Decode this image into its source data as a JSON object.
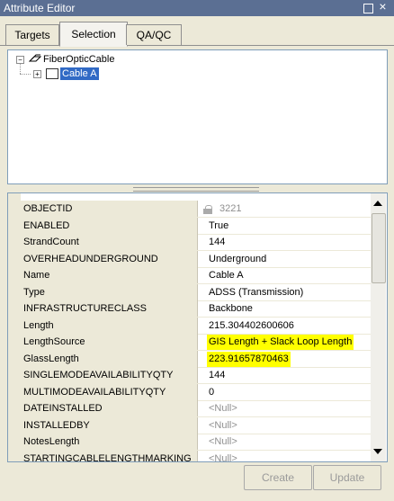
{
  "window": {
    "title": "Attribute Editor"
  },
  "tabs": [
    {
      "label": "Targets",
      "active": false
    },
    {
      "label": "Selection",
      "active": true
    },
    {
      "label": "QA/QC",
      "active": false
    }
  ],
  "tree": {
    "root": {
      "label": "FiberOpticCable",
      "icon": "feature-class-icon",
      "expander": "−"
    },
    "child": {
      "label": "Cable A",
      "icon": "cable-feature-icon",
      "expander": "+"
    }
  },
  "attributes": [
    {
      "name": "OBJECTID",
      "value": "3221",
      "style": "grey",
      "locked": true
    },
    {
      "name": "ENABLED",
      "value": "True"
    },
    {
      "name": "StrandCount",
      "value": "144"
    },
    {
      "name": "OVERHEADUNDERGROUND",
      "value": "Underground"
    },
    {
      "name": "Name",
      "value": "Cable A"
    },
    {
      "name": "Type",
      "value": "ADSS (Transmission)"
    },
    {
      "name": "INFRASTRUCTURECLASS",
      "value": "Backbone"
    },
    {
      "name": "Length",
      "value": "215.304402600606"
    },
    {
      "name": "LengthSource",
      "value": "GIS Length + Slack Loop Length",
      "highlight": true
    },
    {
      "name": "GlassLength",
      "value": "223.91657870463",
      "highlight": true
    },
    {
      "name": "SINGLEMODEAVAILABILITYQTY",
      "value": "144"
    },
    {
      "name": "MULTIMODEAVAILABILITYQTY",
      "value": "0"
    },
    {
      "name": "DATEINSTALLED",
      "value": "<Null>",
      "style": "grey"
    },
    {
      "name": "INSTALLEDBY",
      "value": "<Null>",
      "style": "grey"
    },
    {
      "name": "NotesLength",
      "value": "<Null>",
      "style": "grey"
    },
    {
      "name": "STARTINGCABLELENGTHMARKING",
      "value": "<Null>",
      "style": "grey"
    }
  ],
  "buttons": {
    "create": "Create",
    "update": "Update"
  },
  "colors": {
    "highlight": "#ffff00",
    "selection": "#316ac5",
    "titlebar": "#5b6f93"
  }
}
